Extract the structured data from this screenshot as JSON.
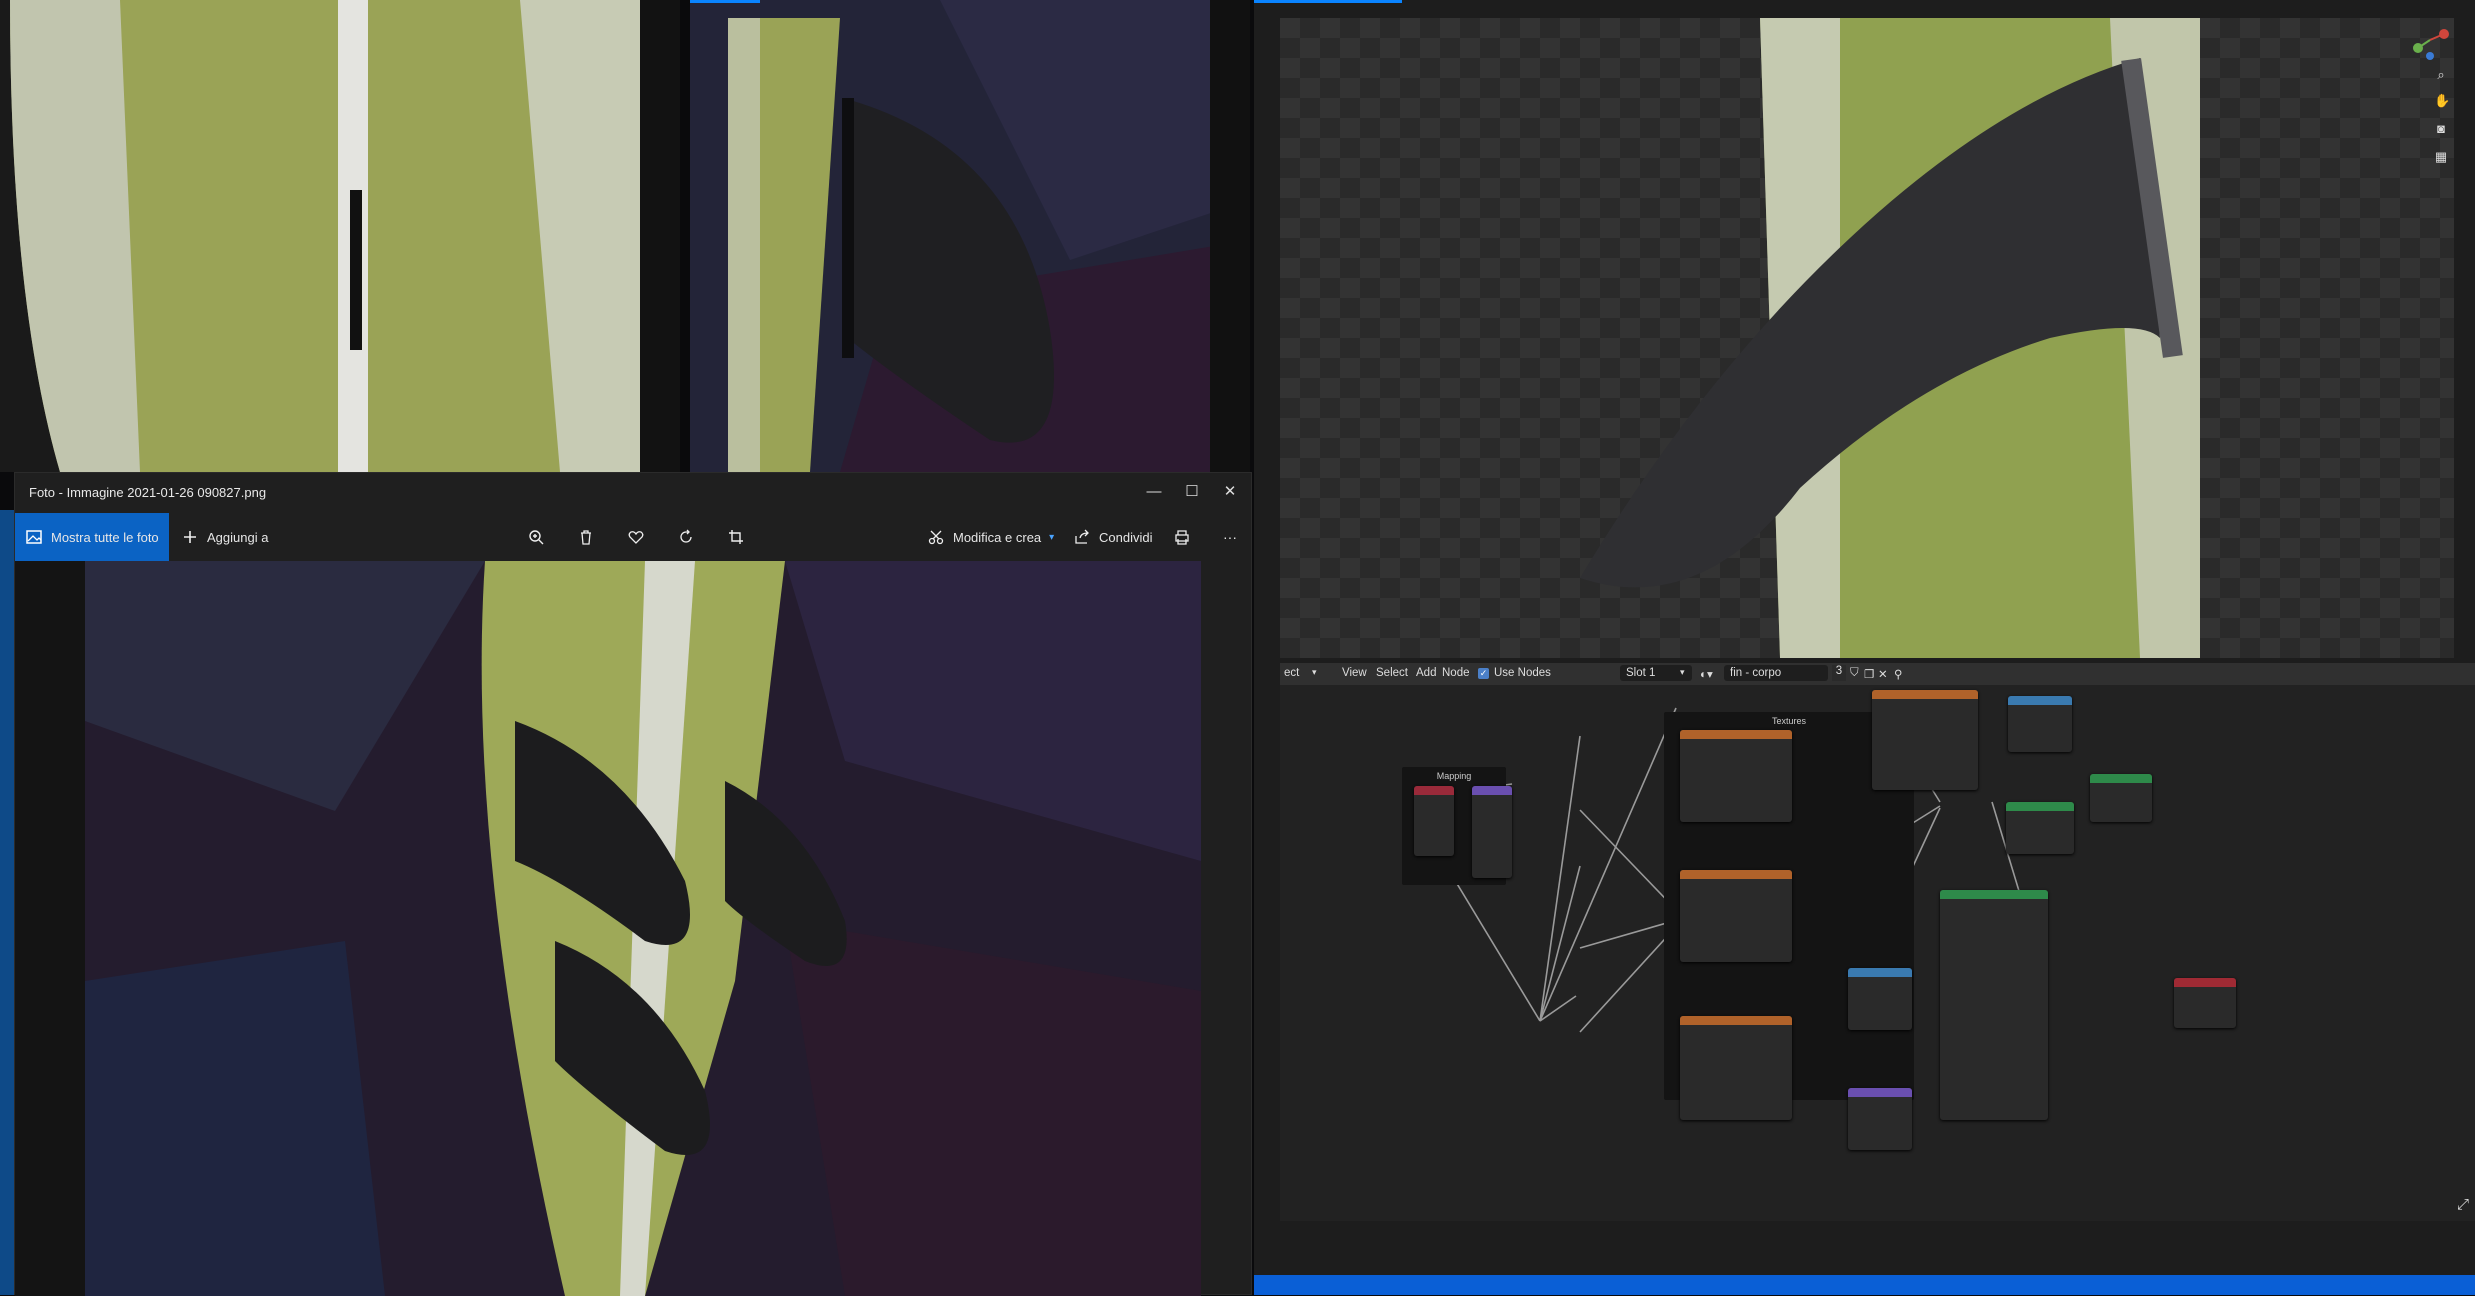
{
  "photos": {
    "window_title": "Foto - Immagine 2021-01-26 090827.png",
    "show_all_label": "Mostra tutte le foto",
    "add_to_label": "Aggiungi a",
    "edit_create_label": "Modifica e crea",
    "share_label": "Condividi",
    "minimize_glyph": "—",
    "maximize_glyph": "☐",
    "close_glyph": "✕",
    "more_glyph": "···",
    "icons": [
      "zoom-in-icon",
      "delete-icon",
      "favorite-icon",
      "rotate-icon",
      "crop-icon",
      "print-icon"
    ]
  },
  "blender": {
    "node_header": {
      "select_label": "ect",
      "view_label": "View",
      "select_menu_label": "Select",
      "add_label": "Add",
      "node_label": "Node",
      "use_nodes_label": "Use Nodes",
      "slot_label": "Slot 1",
      "material_name": "fin - corpo",
      "user_count": "3"
    },
    "frames": {
      "mapping": "Mapping",
      "textures": "Textures"
    }
  },
  "colors": {
    "accent": "#0a84ff",
    "show_all_bg": "#0b63c4",
    "node_texture": "#b0622a",
    "node_vector": "#6a4fb0",
    "node_shader": "#2e8a4a",
    "node_output": "#a02a34",
    "node_input": "#9a2a3a",
    "node_converter": "#3a7ab0"
  }
}
